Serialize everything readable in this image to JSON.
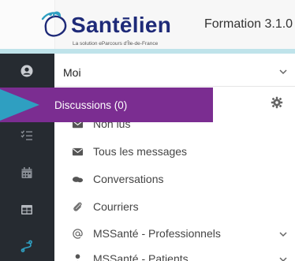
{
  "header": {
    "logo_word": "Santēlien",
    "logo_tagline": "La solution eParcours d'Île-de-France",
    "app_title": "Formation 3.1.0"
  },
  "user_select": {
    "value": "Moi"
  },
  "menu": {
    "active_item": "Discussions (0)",
    "items": [
      {
        "label": "Non lus",
        "icon": "envelope-icon"
      },
      {
        "label": "Tous les messages",
        "icon": "envelope-icon"
      },
      {
        "label": "Conversations",
        "icon": "chat-bubbles-icon"
      },
      {
        "label": "Courriers",
        "icon": "paperclip-icon"
      },
      {
        "label": "MSSanté - Professionnels",
        "icon": "at-icon",
        "expandable": true
      },
      {
        "label": "MSSanté - Patients",
        "icon": "person-icon",
        "expandable": true
      }
    ]
  },
  "colors": {
    "sidebar": "#262b31",
    "active_item": "#7b2d91",
    "accent_teal": "#2f9fc1",
    "teal_band": "#bfe3ea",
    "logo_blue": "#1e2a78"
  }
}
